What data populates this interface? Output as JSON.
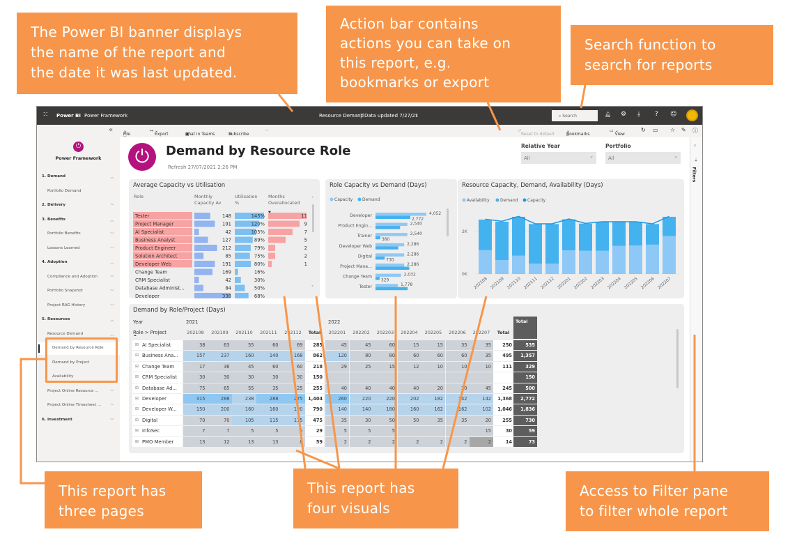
{
  "banner": {
    "app_name": "Power BI",
    "workspace": "Power Framework",
    "report_name": "Resource Demand",
    "separator": "|",
    "data_updated": "Data updated 7/27/21",
    "search_placeholder": "Search"
  },
  "action_bar": {
    "left": [
      "File",
      "Export",
      "Chat in Teams",
      "Subscribe",
      "···"
    ],
    "reset": "Reset to default",
    "bookmarks": "Bookmarks",
    "view": "View"
  },
  "sidebar": {
    "brand": "Power Framework",
    "items": [
      {
        "label": "1. Demand",
        "level": 0,
        "chevron": "up"
      },
      {
        "label": "Portfolio Demand",
        "level": 1,
        "chevron": ""
      },
      {
        "label": "2. Delivery",
        "level": 0,
        "chevron": "down"
      },
      {
        "label": "3. Benefits",
        "level": 0,
        "chevron": "up"
      },
      {
        "label": "Portfolio Benefits",
        "level": 1,
        "chevron": "down"
      },
      {
        "label": "Lessons Learned",
        "level": 1,
        "chevron": "down"
      },
      {
        "label": "4. Adoption",
        "level": 0,
        "chevron": "up"
      },
      {
        "label": "Compliance and Adoption",
        "level": 1,
        "chevron": "down"
      },
      {
        "label": "Portfolio Snapshot",
        "level": 1,
        "chevron": "down"
      },
      {
        "label": "Project RAG History",
        "level": 1,
        "chevron": "down"
      },
      {
        "label": "5. Resources",
        "level": 0,
        "chevron": "up"
      },
      {
        "label": "Resource Demand",
        "level": 1,
        "chevron": "up"
      },
      {
        "label": "Demand by Resource Role",
        "level": 2,
        "chevron": "",
        "selected": true
      },
      {
        "label": "Demand by Project",
        "level": 2,
        "chevron": ""
      },
      {
        "label": "Availability",
        "level": 2,
        "chevron": ""
      },
      {
        "label": "Project Online Resource ...",
        "level": 1,
        "chevron": "down"
      },
      {
        "label": "Project Online Timesheet ...",
        "level": 1,
        "chevron": "down"
      },
      {
        "label": "6. Investment",
        "level": 0,
        "chevron": "down"
      }
    ]
  },
  "report": {
    "title": "Demand by Resource Role",
    "refresh": "Refresh 27/07/2021 2:26 PM",
    "slicers": [
      {
        "label": "Relative Year",
        "value": "All"
      },
      {
        "label": "Portfolio",
        "value": "All"
      }
    ],
    "filters_label": "Filters"
  },
  "colors": {
    "brand": "#b4127e",
    "banner": "#3b3a39",
    "annotation": "#f7964a",
    "capacity": "#8ec8f6",
    "demand": "#45b2f0",
    "capacity_line": "#1a9ae6",
    "overallocated": "#f8a3a3"
  },
  "visual_capacity_util": {
    "title": "Average Capacity vs Utilisation",
    "headers": [
      "Role",
      "Monthly Capacity Av",
      "Utilisation %",
      "Months Overallocated"
    ],
    "rows": [
      {
        "role": "Tester",
        "capacity": 148,
        "util": "145%",
        "over": 11
      },
      {
        "role": "Project Manager",
        "capacity": 191,
        "util": "120%",
        "over": 9
      },
      {
        "role": "AI Specialist",
        "capacity": 42,
        "util": "105%",
        "over": 7
      },
      {
        "role": "Business Analyst",
        "capacity": 127,
        "util": "89%",
        "over": 5
      },
      {
        "role": "Product Engineer",
        "capacity": 212,
        "util": "79%",
        "over": 2
      },
      {
        "role": "Solution Architect",
        "capacity": 85,
        "util": "75%",
        "over": 2
      },
      {
        "role": "Developer Web",
        "capacity": 191,
        "util": "80%",
        "over": 1
      },
      {
        "role": "Change Team",
        "capacity": 169,
        "util": "16%",
        "over": null
      },
      {
        "role": "CRM Specialist",
        "capacity": 42,
        "util": "30%",
        "over": null
      },
      {
        "role": "Database Administ...",
        "capacity": 84,
        "util": "50%",
        "over": null
      },
      {
        "role": "Developer",
        "capacity": 338,
        "util": "68%",
        "over": null
      }
    ]
  },
  "visual_role_capacity": {
    "title": "Role Capacity vs Demand (Days)",
    "legend": [
      "Capacity",
      "Demand"
    ],
    "rows": [
      {
        "role": "Developer",
        "capacity": 4052,
        "demand": 2772,
        "capacity_label": "4,052",
        "demand_label": "2,772"
      },
      {
        "role": "Product Engin...",
        "capacity": 2540,
        "demand": 1960,
        "capacity_label": "2,540",
        "demand_label": ""
      },
      {
        "role": "Trainer",
        "capacity": 2540,
        "demand": 380,
        "capacity_label": "2,540",
        "demand_label": "380"
      },
      {
        "role": "Developer Web",
        "capacity": 2286,
        "demand": 1810,
        "capacity_label": "2,286",
        "demand_label": ""
      },
      {
        "role": "Digital",
        "capacity": 2286,
        "demand": 730,
        "capacity_label": "2,286",
        "demand_label": "730"
      },
      {
        "role": "Project Mana...",
        "capacity": 2286,
        "demand": 2690,
        "capacity_label": "2,286",
        "demand_label": ""
      },
      {
        "role": "Change Team",
        "capacity": 2032,
        "demand": 329,
        "capacity_label": "2,032",
        "demand_label": "329"
      },
      {
        "role": "Tester",
        "capacity": 1778,
        "demand": 2560,
        "capacity_label": "1,778",
        "demand_label": ""
      }
    ]
  },
  "visual_resource_cda": {
    "title": "Resource Capacity, Demand, Availability (Days)",
    "legend": [
      "Availability",
      "Demand",
      "Capacity"
    ],
    "type": "stacked-bar-with-line",
    "yticks": [
      "0K",
      "2K"
    ],
    "ylim": [
      0,
      2800
    ],
    "months": [
      "202108",
      "202109",
      "202110",
      "202111",
      "202112",
      "202201",
      "202202",
      "202203",
      "202204",
      "202205",
      "202206",
      "202207"
    ],
    "availability": [
      1120,
      650,
      860,
      490,
      490,
      1110,
      1090,
      1090,
      1320,
      1340,
      1380,
      1780
    ],
    "demand": [
      1440,
      1810,
      1830,
      1860,
      1860,
      1460,
      1280,
      1370,
      1140,
      1120,
      970,
      910
    ],
    "capacity": [
      2580,
      2480,
      2710,
      2360,
      2360,
      2590,
      2380,
      2460,
      2460,
      2460,
      2360,
      2710
    ]
  },
  "matrix": {
    "title": "Demand by Role/Project (Days)",
    "year_label": "Year",
    "row_header": "Role > Project",
    "years": [
      "2021",
      "2022"
    ],
    "months_2021": [
      "202108",
      "202109",
      "202110",
      "202111",
      "202112"
    ],
    "months_2022": [
      "202201",
      "202202",
      "202203",
      "202204",
      "202205",
      "202206",
      "202207"
    ],
    "total_label": "Total",
    "rows": [
      {
        "role": "AI Specialist",
        "y2021": [
          38,
          63,
          55,
          60,
          69
        ],
        "t2021": "285",
        "y2022": [
          45,
          45,
          60,
          15,
          15,
          35,
          35
        ],
        "t2022": "250",
        "total": "535"
      },
      {
        "role": "Business Ana...",
        "y2021": [
          157,
          237,
          160,
          140,
          168
        ],
        "t2021": "862",
        "y2022": [
          120,
          80,
          80,
          60,
          60,
          60,
          35
        ],
        "t2022": "495",
        "total": "1,357"
      },
      {
        "role": "Change Team",
        "y2021": [
          17,
          36,
          45,
          60,
          60
        ],
        "t2021": "218",
        "y2022": [
          29,
          25,
          15,
          12,
          10,
          10,
          10
        ],
        "t2022": "111",
        "total": "329"
      },
      {
        "role": "CRM Specialist",
        "y2021": [
          30,
          30,
          30,
          30,
          30
        ],
        "t2021": "150",
        "y2022": [
          null,
          null,
          null,
          null,
          null,
          null,
          null
        ],
        "t2022": "",
        "total": "150"
      },
      {
        "role": "Database Ad...",
        "y2021": [
          75,
          65,
          55,
          35,
          25
        ],
        "t2021": "255",
        "y2022": [
          40,
          40,
          40,
          40,
          20,
          20,
          45
        ],
        "t2022": "245",
        "total": "500"
      },
      {
        "role": "Developer",
        "y2021": [
          315,
          288,
          238,
          288,
          275
        ],
        "t2021": "1,404",
        "y2022": [
          260,
          220,
          220,
          202,
          182,
          142,
          142
        ],
        "t2022": "1,368",
        "total": "2,772"
      },
      {
        "role": "Developer W...",
        "y2021": [
          150,
          200,
          160,
          160,
          120
        ],
        "t2021": "790",
        "y2022": [
          140,
          140,
          180,
          160,
          162,
          162,
          102
        ],
        "t2022": "1,046",
        "total": "1,836"
      },
      {
        "role": "Digital",
        "y2021": [
          70,
          70,
          105,
          115,
          115
        ],
        "t2021": "475",
        "y2022": [
          35,
          30,
          50,
          50,
          35,
          35,
          20
        ],
        "t2022": "255",
        "total": "730"
      },
      {
        "role": "InfoSec",
        "y2021": [
          7,
          7,
          5,
          5,
          5
        ],
        "t2021": "29",
        "y2022": [
          5,
          5,
          5,
          null,
          null,
          null,
          15
        ],
        "t2022": "30",
        "total": "59"
      },
      {
        "role": "PMO Member",
        "y2021": [
          13,
          12,
          13,
          13,
          8
        ],
        "t2021": "59",
        "y2022": [
          2,
          2,
          2,
          2,
          2,
          2,
          2
        ],
        "t2022": "14",
        "total": "73"
      }
    ]
  },
  "annotations": {
    "banner": [
      "The Power BI banner displays",
      "the name of the report and",
      "the date it was last updated."
    ],
    "action_bar": [
      "Action bar contains",
      "actions you can take on",
      "this report, e.g.",
      "bookmarks or export"
    ],
    "search": [
      "Search function to",
      "search for reports"
    ],
    "pages": [
      "This report has",
      "three pages"
    ],
    "visuals": [
      "This report has",
      "four visuals"
    ],
    "filters": [
      "Access to Filter pane",
      "to filter whole report"
    ]
  }
}
